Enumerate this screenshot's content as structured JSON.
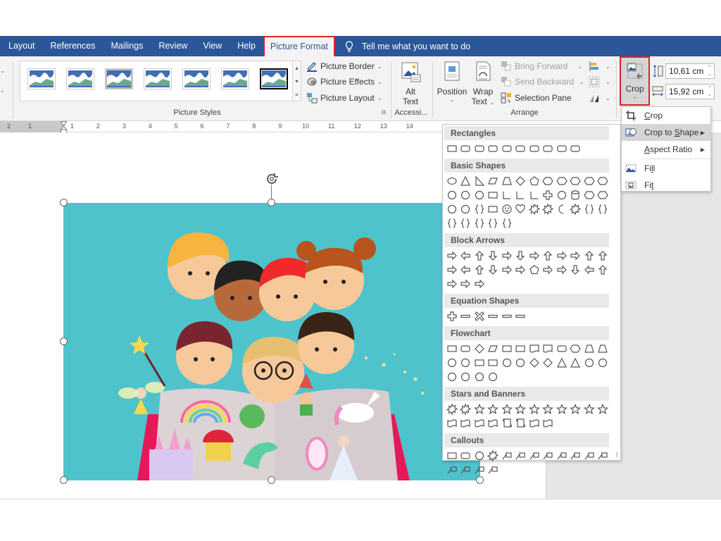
{
  "tabs": [
    {
      "label": "Layout"
    },
    {
      "label": "References"
    },
    {
      "label": "Mailings"
    },
    {
      "label": "Review"
    },
    {
      "label": "View"
    },
    {
      "label": "Help"
    },
    {
      "label": "Picture Format",
      "active": true
    }
  ],
  "tell_me": {
    "placeholder": "Tell me what you want to do",
    "icon": "lightbulb-icon"
  },
  "ribbon": {
    "picture_styles": {
      "label": "Picture Styles",
      "style_count": 7,
      "selected_index": 6,
      "border_label": "Picture Border",
      "effects_label": "Picture Effects",
      "layout_label": "Picture Layout"
    },
    "accessibility": {
      "label": "Accessi...",
      "alt_text_line1": "Alt",
      "alt_text_line2": "Text"
    },
    "arrange": {
      "label": "Arrange",
      "position_label": "Position",
      "wrap_line1": "Wrap",
      "wrap_line2": "Text",
      "bring_forward_label": "Bring Forward",
      "send_backward_label": "Send Backward",
      "selection_pane_label": "Selection Pane"
    },
    "size": {
      "crop_label": "Crop",
      "height_value": "10,61 cm",
      "width_value": "15,92 cm"
    }
  },
  "ruler": {
    "left_ticks": [
      "2",
      "1"
    ],
    "right_ticks": [
      "1",
      "2",
      "3",
      "4",
      "5",
      "6",
      "7",
      "8",
      "9",
      "10",
      "11",
      "12",
      "13",
      "14"
    ]
  },
  "crop_menu": {
    "items": [
      {
        "label": "Crop",
        "icon": "crop-icon",
        "accel": "C"
      },
      {
        "label": "Crop to Shape",
        "icon": "crop-to-shape-icon",
        "accel": "S",
        "submenu": true,
        "highlighted": true
      },
      {
        "label": "Aspect Ratio",
        "icon": "",
        "accel": "A",
        "submenu": true
      },
      {
        "label": "Fill",
        "icon": "fill-icon",
        "accel": "l"
      },
      {
        "label": "Fit",
        "icon": "fit-icon",
        "accel": "t"
      }
    ]
  },
  "shapes_gallery": {
    "sections": [
      {
        "title": "Rectangles",
        "shapes": [
          "rectangle",
          "rounded-rectangle",
          "snip-single-corner",
          "snip-same-side",
          "snip-diagonal",
          "snip-round",
          "round-single-corner",
          "round-same-side",
          "round-diagonal",
          "rect-rounded-2"
        ]
      },
      {
        "title": "Basic Shapes",
        "shapes": [
          "oval",
          "triangle",
          "right-triangle",
          "parallelogram",
          "trapezoid",
          "diamond",
          "pentagon",
          "hexagon",
          "heptagon-7",
          "octagon-8",
          "decagon-10",
          "dodecagon-12",
          "pie",
          "chord",
          "teardrop",
          "frame",
          "half-frame",
          "l-shape",
          "diagonal-stripe",
          "cross",
          "plaque",
          "can",
          "cube",
          "bevel",
          "donut",
          "no-symbol",
          "block-arc",
          "folded-corner",
          "smiley",
          "heart",
          "lightning",
          "sun",
          "moon",
          "cloud",
          "arc",
          "double-bracket",
          "double-brace",
          "left-bracket",
          "right-bracket",
          "left-brace",
          "right-brace"
        ]
      },
      {
        "title": "Block Arrows",
        "shapes": [
          "right-arrow",
          "left-arrow",
          "up-arrow",
          "down-arrow",
          "left-right-arrow",
          "up-down-arrow",
          "quad-arrow",
          "left-right-up-arrow",
          "bent-arrow",
          "u-turn-arrow",
          "left-up-arrow",
          "bent-up-arrow",
          "curved-right-arrow",
          "curved-left-arrow",
          "curved-up-arrow",
          "curved-down-arrow",
          "striped-right-arrow",
          "notched-right-arrow",
          "pentagon-arrow",
          "chevron",
          "right-arrow-callout",
          "down-arrow-callout",
          "left-arrow-callout",
          "up-arrow-callout",
          "left-right-arrow-callout",
          "quad-arrow-callout",
          "circular-arrow"
        ]
      },
      {
        "title": "Equation Shapes",
        "shapes": [
          "plus",
          "minus",
          "multiply",
          "division",
          "equal",
          "not-equal"
        ]
      },
      {
        "title": "Flowchart",
        "shapes": [
          "process",
          "alternate-process",
          "decision",
          "data",
          "predefined-process",
          "internal-storage",
          "document",
          "multidocument",
          "terminator",
          "preparation",
          "manual-input",
          "manual-operation",
          "connector",
          "off-page-connector",
          "card",
          "punched-tape",
          "summing-junction",
          "or",
          "collate",
          "sort",
          "extract",
          "merge",
          "stored-data",
          "delay",
          "sequential-access",
          "magnetic-disk",
          "direct-access",
          "display"
        ]
      },
      {
        "title": "Stars and Banners",
        "shapes": [
          "explosion-1",
          "explosion-2",
          "star-4",
          "star-5",
          "star-6",
          "star-7",
          "star-8",
          "star-10",
          "star-12",
          "star-16",
          "star-24",
          "star-32",
          "ribbon-up",
          "ribbon-down",
          "curved-ribbon-up",
          "curved-ribbon-down",
          "vertical-scroll",
          "horizontal-scroll",
          "wave",
          "double-wave"
        ]
      },
      {
        "title": "Callouts",
        "shapes": [
          "rect-callout",
          "rounded-rect-callout",
          "oval-callout",
          "cloud-callout",
          "line-callout-1",
          "line-callout-2",
          "line-callout-3",
          "line-callout-1-accent",
          "line-callout-2-accent",
          "line-callout-3-accent",
          "line-callout-1-noborder",
          "line-callout-2-noborder",
          "line-callout-3-noborder",
          "line-callout-1-border-accent",
          "line-callout-2-border-accent",
          "line-callout-3-border-accent"
        ]
      }
    ]
  },
  "document": {
    "picture": {
      "description": "Illustration of children reading a fairy-tale book",
      "background_color": "#4ec3cc"
    }
  },
  "colors": {
    "ribbon_blue": "#2b579a",
    "highlight_red": "#e0202a",
    "ribbon_bg": "#f3f3f3"
  }
}
